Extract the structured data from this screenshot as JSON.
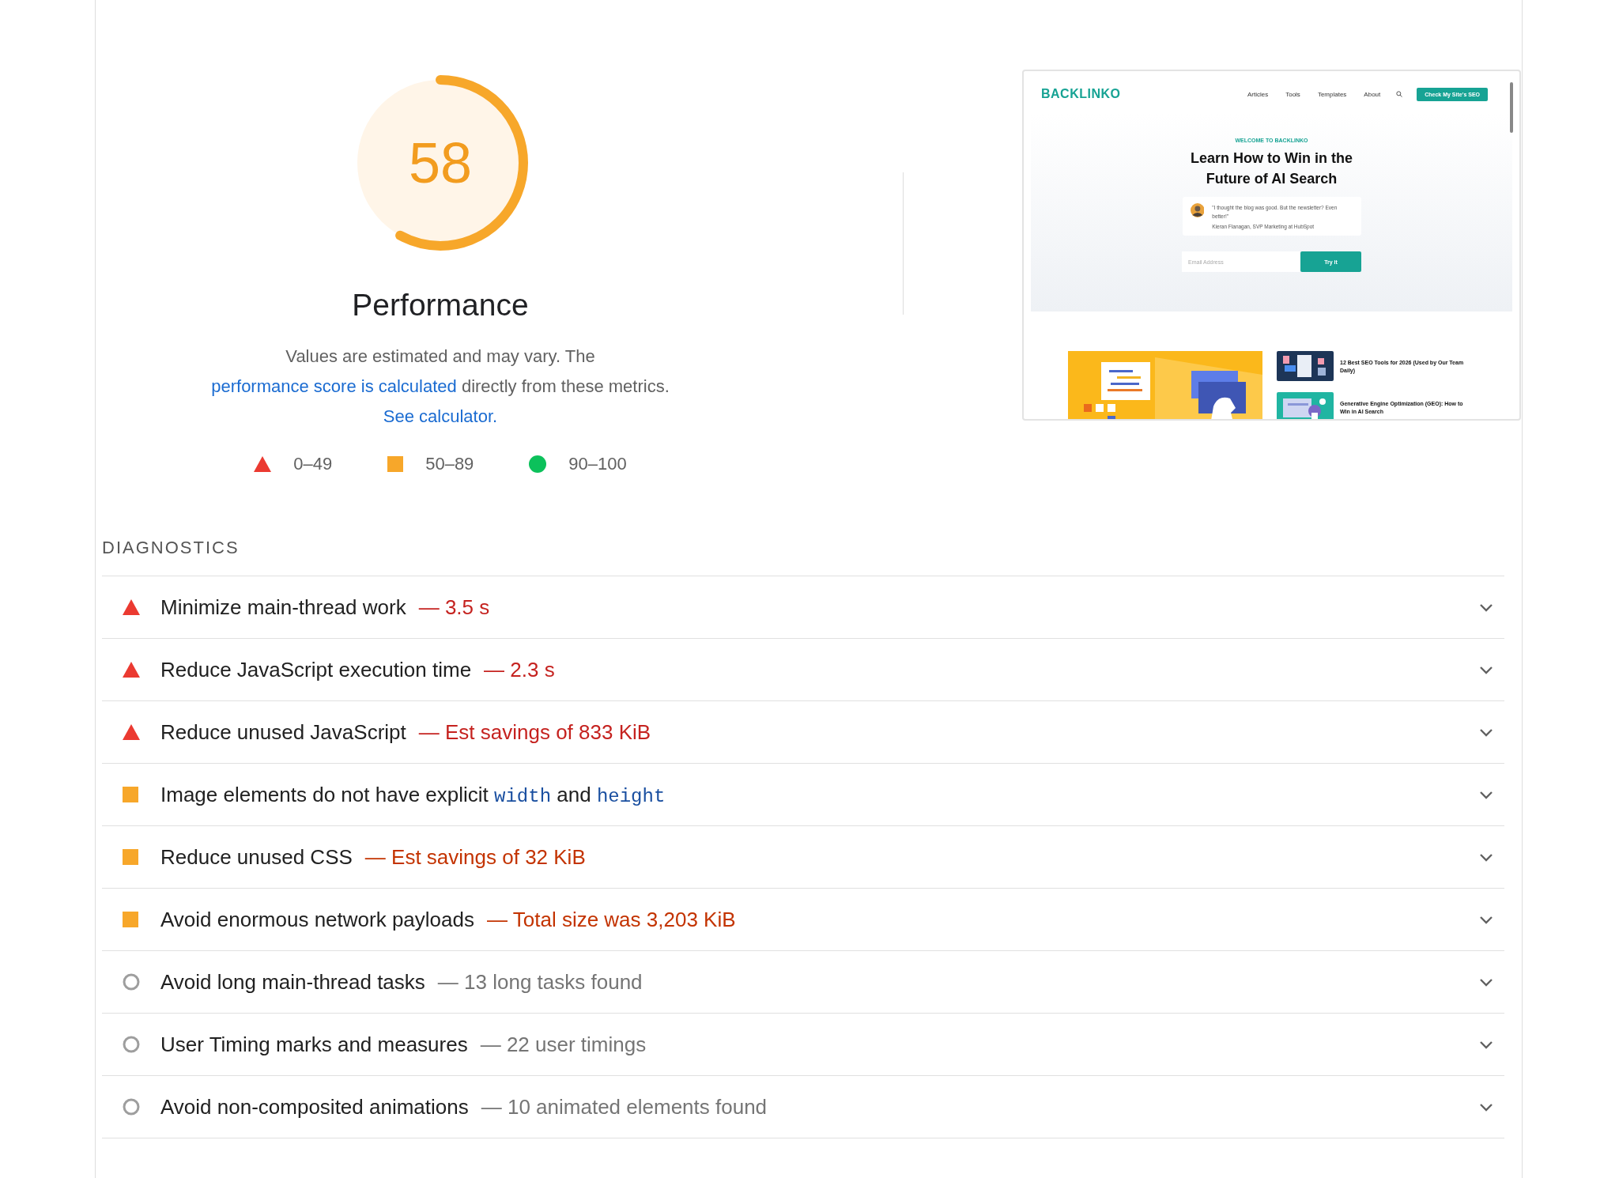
{
  "score": {
    "value": "58",
    "level": 0.58,
    "title": "Performance"
  },
  "description": [
    {
      "kind": "text",
      "text": "Values are estimated and may vary. The "
    },
    {
      "kind": "link",
      "text": "performance score is calculated"
    },
    {
      "kind": "text",
      "text": " directly from these metrics. "
    },
    {
      "kind": "link",
      "text": "See calculator."
    }
  ],
  "legend": [
    {
      "kind": "fail",
      "label": "0–49"
    },
    {
      "kind": "average",
      "label": "50–89"
    },
    {
      "kind": "pass",
      "label": "90–100"
    }
  ],
  "screenshot": {
    "logo": "BACKLINKO",
    "nav": [
      "Articles",
      "Tools",
      "Templates",
      "About"
    ],
    "cta": "Check My Site's SEO",
    "eyebrow": "WELCOME TO BACKLINKO",
    "headline": "Learn How to Win in the Future of AI Search",
    "quote": "\"I thought the blog was good. But the newsletter? Even better!\"",
    "attribution": "Kieran Flanagan, SVP Marketing at HubSpot",
    "email_placeholder": "Email Address",
    "submit": "Try it",
    "articles": [
      {
        "title": "12 Best SEO Tools for 2026 (Used by Our Team Daily)",
        "kind": "navy"
      },
      {
        "title": "Generative Engine Optimization (GEO): How to Win in AI Search",
        "kind": "teal"
      }
    ]
  },
  "diagnostics": {
    "heading": "DIAGNOSTICS",
    "items": [
      {
        "kind": "fail",
        "title": "Minimize main-thread work",
        "detail": "— 3.5 s"
      },
      {
        "kind": "fail",
        "title": "Reduce JavaScript execution time",
        "detail": "— 2.3 s"
      },
      {
        "kind": "fail",
        "title": "Reduce unused JavaScript",
        "detail": "— Est savings of 833 KiB"
      },
      {
        "kind": "average",
        "title_parts": [
          {
            "kind": "text",
            "text": "Image elements do not have explicit "
          },
          {
            "kind": "code",
            "text": "width"
          },
          {
            "kind": "text",
            "text": " and "
          },
          {
            "kind": "code",
            "text": "height"
          }
        ]
      },
      {
        "kind": "average",
        "title": "Reduce unused CSS",
        "detail": "— Est savings of 32 KiB"
      },
      {
        "kind": "average",
        "title": "Avoid enormous network payloads",
        "detail": "— Total size was 3,203 KiB"
      },
      {
        "kind": "info",
        "title": "Avoid long main-thread tasks",
        "detail": "— 13 long tasks found"
      },
      {
        "kind": "info",
        "title": "User Timing marks and measures",
        "detail": "— 22 user timings"
      },
      {
        "kind": "info",
        "title": "Avoid non-composited animations",
        "detail": "— 10 animated elements found"
      }
    ]
  }
}
